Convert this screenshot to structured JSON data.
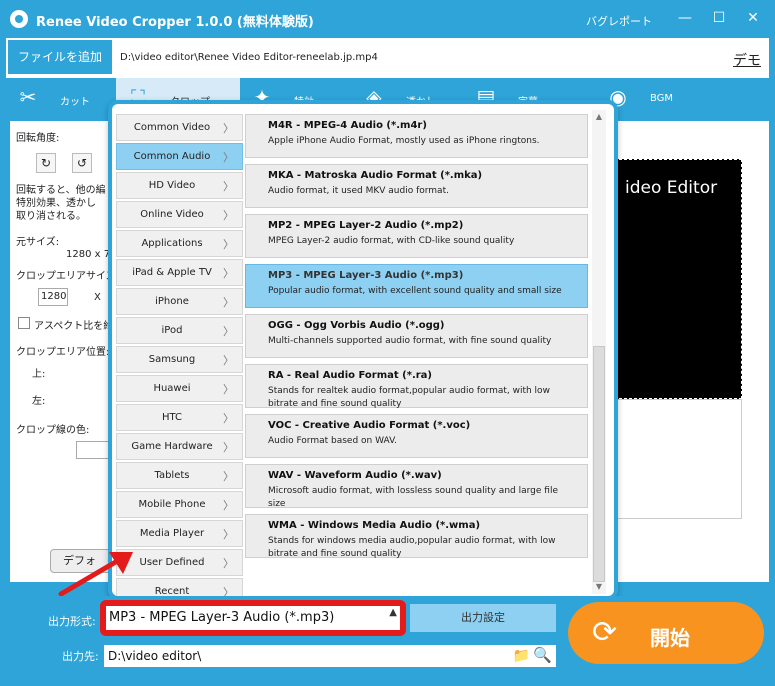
{
  "titlebar": {
    "title": "Renee Video Cropper 1.0.0 (無料体験版)",
    "bug_report": "バグレポート",
    "minimize": "—",
    "maximize": "☐",
    "close": "✕"
  },
  "toolbar": {
    "add_file": "ファイルを追加",
    "file_path": "D:\\video editor\\Renee Video Editor-reneelab.jp.mp4",
    "demo": "デモ"
  },
  "tabs": [
    {
      "label": "カット",
      "icon": "scissors-icon"
    },
    {
      "label": "クロップ",
      "icon": "crop-icon"
    },
    {
      "label": "特効",
      "icon": "effects-icon"
    },
    {
      "label": "透かし",
      "icon": "watermark-icon"
    },
    {
      "label": "字幕",
      "icon": "subtitle-icon"
    },
    {
      "label": "BGM",
      "icon": "music-icon"
    }
  ],
  "crop_panel": {
    "rotation_label": "回転角度:",
    "rotate_cw": "↻",
    "rotate_ccw": "↺",
    "note_line1": "回転すると、他の編",
    "note_line2": "特別効果、透かし",
    "note_line3": "取り消される。",
    "original_size_label": "元サイズ:",
    "original_size_value": "1280 x 7",
    "crop_area_size_label": "クロップエリアサイズ:",
    "crop_width": "1280",
    "crop_x": "X",
    "aspect_label": "アスペクト比を維",
    "crop_pos_label": "クロップエリア位置:",
    "top_label": "上:",
    "left_label": "左:",
    "line_color_label": "クロップ線の色:",
    "default_button": "デフォ"
  },
  "preview": {
    "text": "ideo Editor"
  },
  "format_popup": {
    "categories": [
      "Common Video",
      "Common Audio",
      "HD Video",
      "Online Video",
      "Applications",
      "iPad & Apple TV",
      "iPhone",
      "iPod",
      "Samsung",
      "Huawei",
      "HTC",
      "Game Hardware",
      "Tablets",
      "Mobile Phone",
      "Media Player",
      "User Defined",
      "Recent"
    ],
    "active_category": "Common Audio",
    "formats": [
      {
        "name": "M4R - MPEG-4 Audio (*.m4r)",
        "desc": "Apple iPhone Audio Format, mostly used as iPhone ringtons."
      },
      {
        "name": "MKA - Matroska Audio Format (*.mka)",
        "desc": "Audio format, it used MKV audio format."
      },
      {
        "name": "MP2 - MPEG Layer-2 Audio (*.mp2)",
        "desc": "MPEG Layer-2 audio format, with CD-like sound quality"
      },
      {
        "name": "MP3 - MPEG Layer-3 Audio (*.mp3)",
        "desc": "Popular audio format, with excellent sound quality and small size"
      },
      {
        "name": "OGG - Ogg Vorbis Audio (*.ogg)",
        "desc": "Multi-channels supported audio format, with fine sound quality"
      },
      {
        "name": "RA - Real Audio Format (*.ra)",
        "desc": "Stands for realtek audio format,popular audio format, with low bitrate and fine sound quality"
      },
      {
        "name": "VOC - Creative Audio Format (*.voc)",
        "desc": "Audio Format based on WAV."
      },
      {
        "name": "WAV - Waveform Audio (*.wav)",
        "desc": "Microsoft audio format, with lossless sound quality and large file size"
      },
      {
        "name": "WMA - Windows Media Audio (*.wma)",
        "desc": "Stands for windows media audio,popular audio format, with low bitrate and fine sound quality"
      }
    ],
    "active_format_index": 3,
    "category_arrow": "〉",
    "scroll_up": "▲",
    "scroll_down": "▼"
  },
  "bottom": {
    "output_format_label": "出力形式:",
    "output_format_value": "MP3 - MPEG Layer-3 Audio (*.mp3)",
    "dropdown_arrow": "▲",
    "output_settings": "出力設定",
    "start": "開始",
    "start_icon": "⟳",
    "destination_label": "出力先:",
    "destination_value": "D:\\video editor\\",
    "folder_icon": "📁",
    "search_icon": "🔍"
  },
  "colors": {
    "accent": "#2ea4d8",
    "selected": "#8ed0f2",
    "start_button": "#f7931e",
    "highlight_border": "#e31b1b"
  }
}
